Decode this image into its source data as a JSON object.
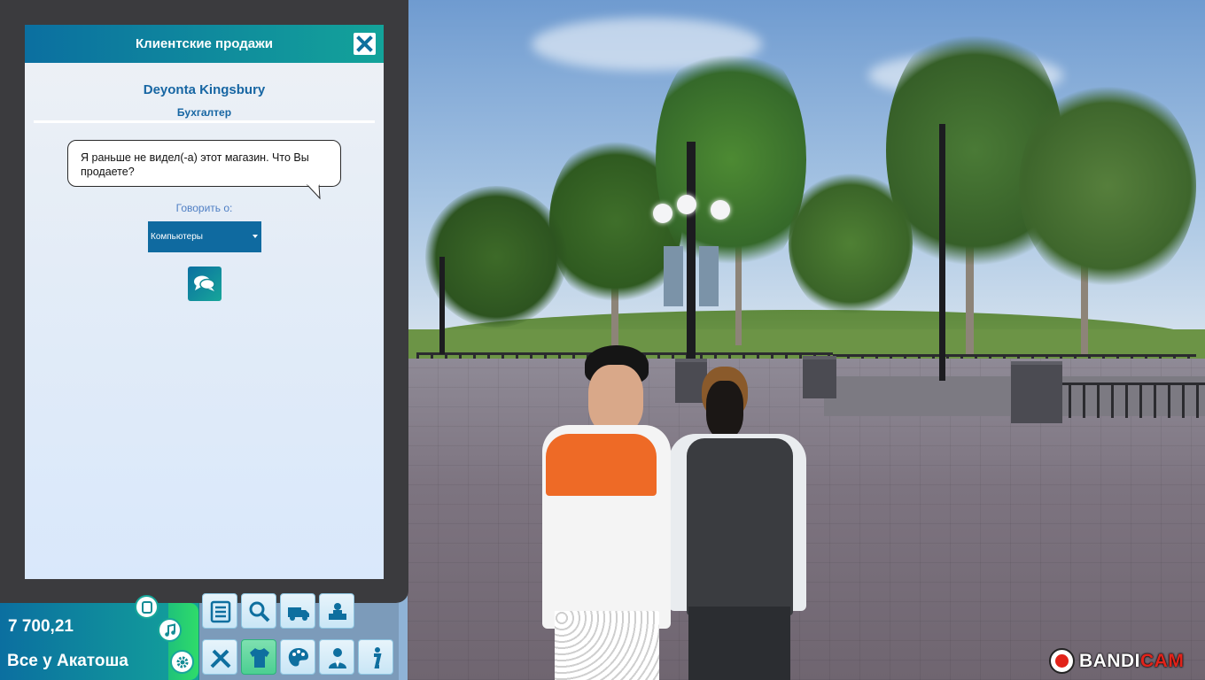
{
  "dialog": {
    "title": "Клиентские продажи",
    "npc_name": "Deyonta Kingsbury",
    "npc_job": "Бухгалтер",
    "speech": "Я раньше не видел(-а) этот магазин. Что Вы продаете?",
    "talk_about_label": "Говорить о:",
    "topic_selected": "Компьютеры"
  },
  "hud": {
    "money": "7 700,21",
    "store_name": "Все у Акатоша",
    "tools": [
      "checklist-icon",
      "search-icon",
      "truck-icon",
      "cashier-icon",
      "tools-icon",
      "shirt-icon",
      "palette-icon",
      "employee-icon",
      "info-icon"
    ],
    "active_tool": "shirt-icon"
  },
  "watermark": {
    "bandi": "BANDI",
    "cam": "CAM"
  },
  "colors": {
    "header_start": "#0b6fa0",
    "header_end": "#13a39a",
    "accent_text": "#1766a3",
    "hud_green": "#2fdc6a"
  }
}
